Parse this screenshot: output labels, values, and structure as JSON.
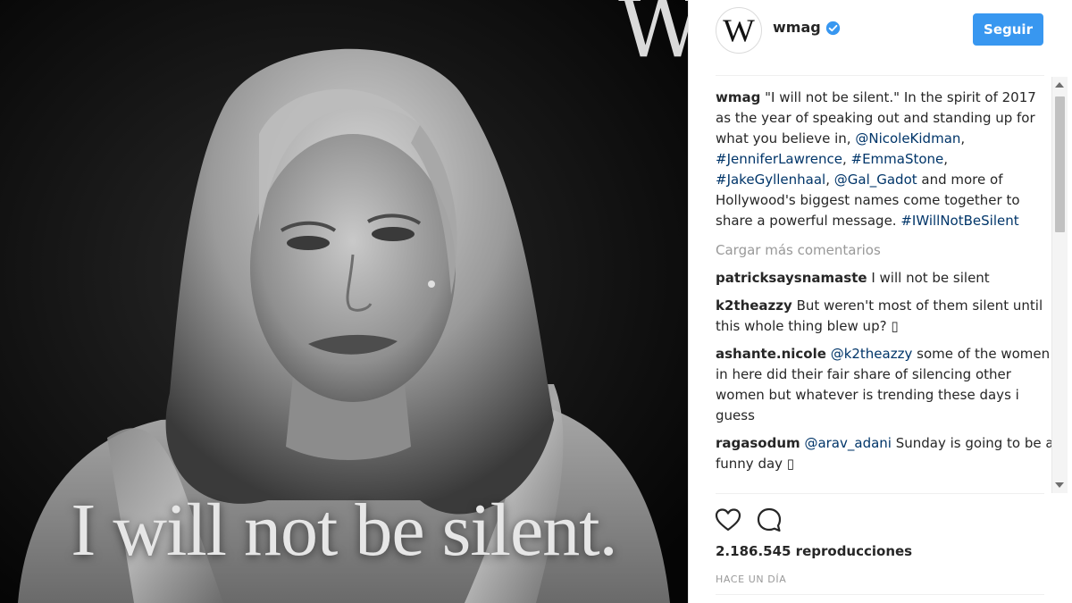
{
  "media": {
    "brand_mark": "W",
    "overlay_text": "I will not be silent."
  },
  "header": {
    "avatar_letter": "W",
    "username": "wmag",
    "verified": true,
    "follow_label": "Seguir"
  },
  "caption": {
    "username": "wmag",
    "text_1": "\"I will not be silent.\" In the spirit of 2017 as the year of speaking out and standing up for what you believe in, ",
    "mention_1": "@NicoleKidman",
    "sep_1": ", ",
    "tag_1": "#JenniferLawrence",
    "sep_2": ", ",
    "tag_2": "#EmmaStone",
    "sep_3": ", ",
    "tag_3": "#JakeGyllenhaal",
    "sep_4": ", ",
    "mention_2": "@Gal_Gadot",
    "text_2": " and more of Hollywood's biggest names come together to share a powerful message. ",
    "tag_4": "#IWillNotBeSilent"
  },
  "load_more_label": "Cargar más comentarios",
  "comments": [
    {
      "username": "patricksaysnamaste",
      "text": "I will not be silent"
    },
    {
      "username": "k2theazzy",
      "text": "But weren't most of them silent until this whole thing blew up? ▯"
    },
    {
      "username": "ashante.nicole",
      "mention": "@k2theazzy",
      "text": " some of the women in here did their fair share of silencing other women but whatever is trending these days i guess"
    },
    {
      "username": "ragasodum",
      "mention": "@arav_adani",
      "text": " Sunday is going to be a funny day ▯"
    }
  ],
  "stats": {
    "views": "2.186.545 reproducciones",
    "time": "HACE UN DÍA"
  },
  "icons": {
    "like": "heart-icon",
    "comment": "comment-bubble-icon",
    "verified": "verified-badge-icon"
  },
  "colors": {
    "accent": "#3897f0",
    "link": "#003569",
    "muted": "#999999"
  }
}
